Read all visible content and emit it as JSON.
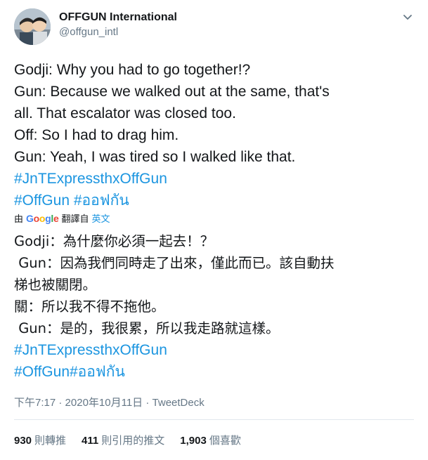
{
  "author": {
    "name": "OFFGUN International",
    "handle": "@offgun_intl"
  },
  "tweet_lines": [
    "Godji: Why you had to go together!?",
    "Gun: Because we walked out at the same, that's",
    "all. That escalator was closed too.",
    "Off: So I had to drag him.",
    "Gun: Yeah, I was tired so I walked like that."
  ],
  "hashtags": {
    "tag1": "#JnTExpressthxOffGun",
    "tag2": "#OffGun",
    "tag3": "#ออฟกัน"
  },
  "translation_notice": {
    "prefix": "由",
    "provider": "Google",
    "suffix": "翻譯自",
    "source_language": "英文"
  },
  "translated_lines": [
    "Godji：為什麼你必須一起去！？",
    " Gun：因為我們同時走了出來，僅此而已。該自動扶",
    "梯也被關閉。",
    "關：所以我不得不拖他。",
    " Gun：是的，我很累，所以我走路就這樣。"
  ],
  "translated_hashtags": {
    "tag1": "#JnTExpressthxOffGun",
    "tag2": "#OffGun#ออฟกัน"
  },
  "meta": {
    "time": "下午7:17",
    "separator": "·",
    "date": "2020年10月11日",
    "source": "TweetDeck"
  },
  "stats": {
    "retweets_count": "930",
    "retweets_label": "則轉推",
    "quotes_count": "411",
    "quotes_label": "則引用的推文",
    "likes_count": "1,903",
    "likes_label": "個喜歡"
  },
  "icons": {
    "menu": "chevron-down-icon"
  },
  "colors": {
    "link": "#1b95e0",
    "secondary_text": "#657786",
    "divider": "#e1e8ed"
  }
}
